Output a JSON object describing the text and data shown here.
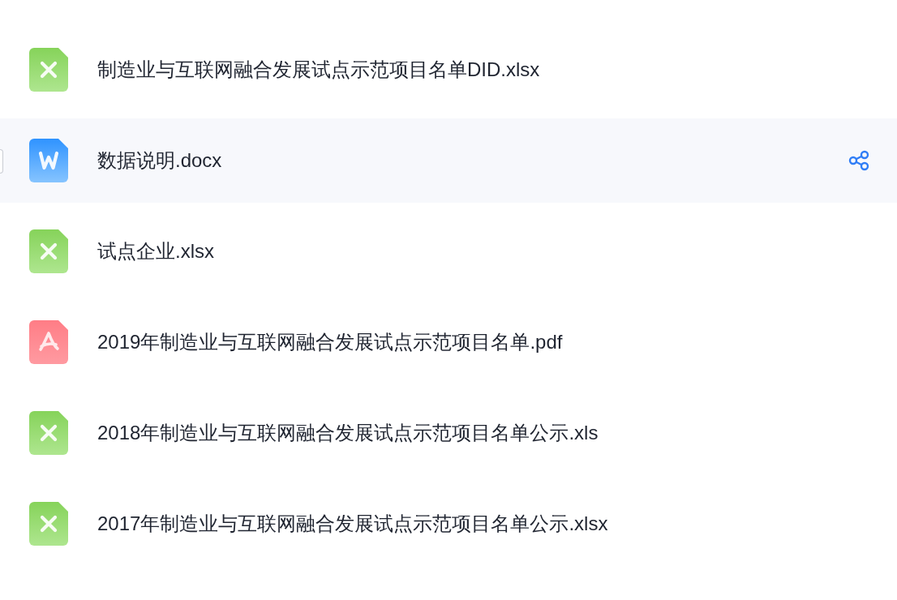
{
  "files": [
    {
      "kind": "excel",
      "name": "制造业与互联网融合发展试点示范项目名单DID.xlsx",
      "hovered": false
    },
    {
      "kind": "word",
      "name": "数据说明.docx",
      "hovered": true
    },
    {
      "kind": "excel",
      "name": "试点企业.xlsx",
      "hovered": false
    },
    {
      "kind": "pdf",
      "name": "2019年制造业与互联网融合发展试点示范项目名单.pdf",
      "hovered": false
    },
    {
      "kind": "excel",
      "name": "2018年制造业与互联网融合发展试点示范项目名单公示.xls",
      "hovered": false
    },
    {
      "kind": "excel",
      "name": "2017年制造业与互联网融合发展试点示范项目名单公示.xlsx",
      "hovered": false
    }
  ]
}
